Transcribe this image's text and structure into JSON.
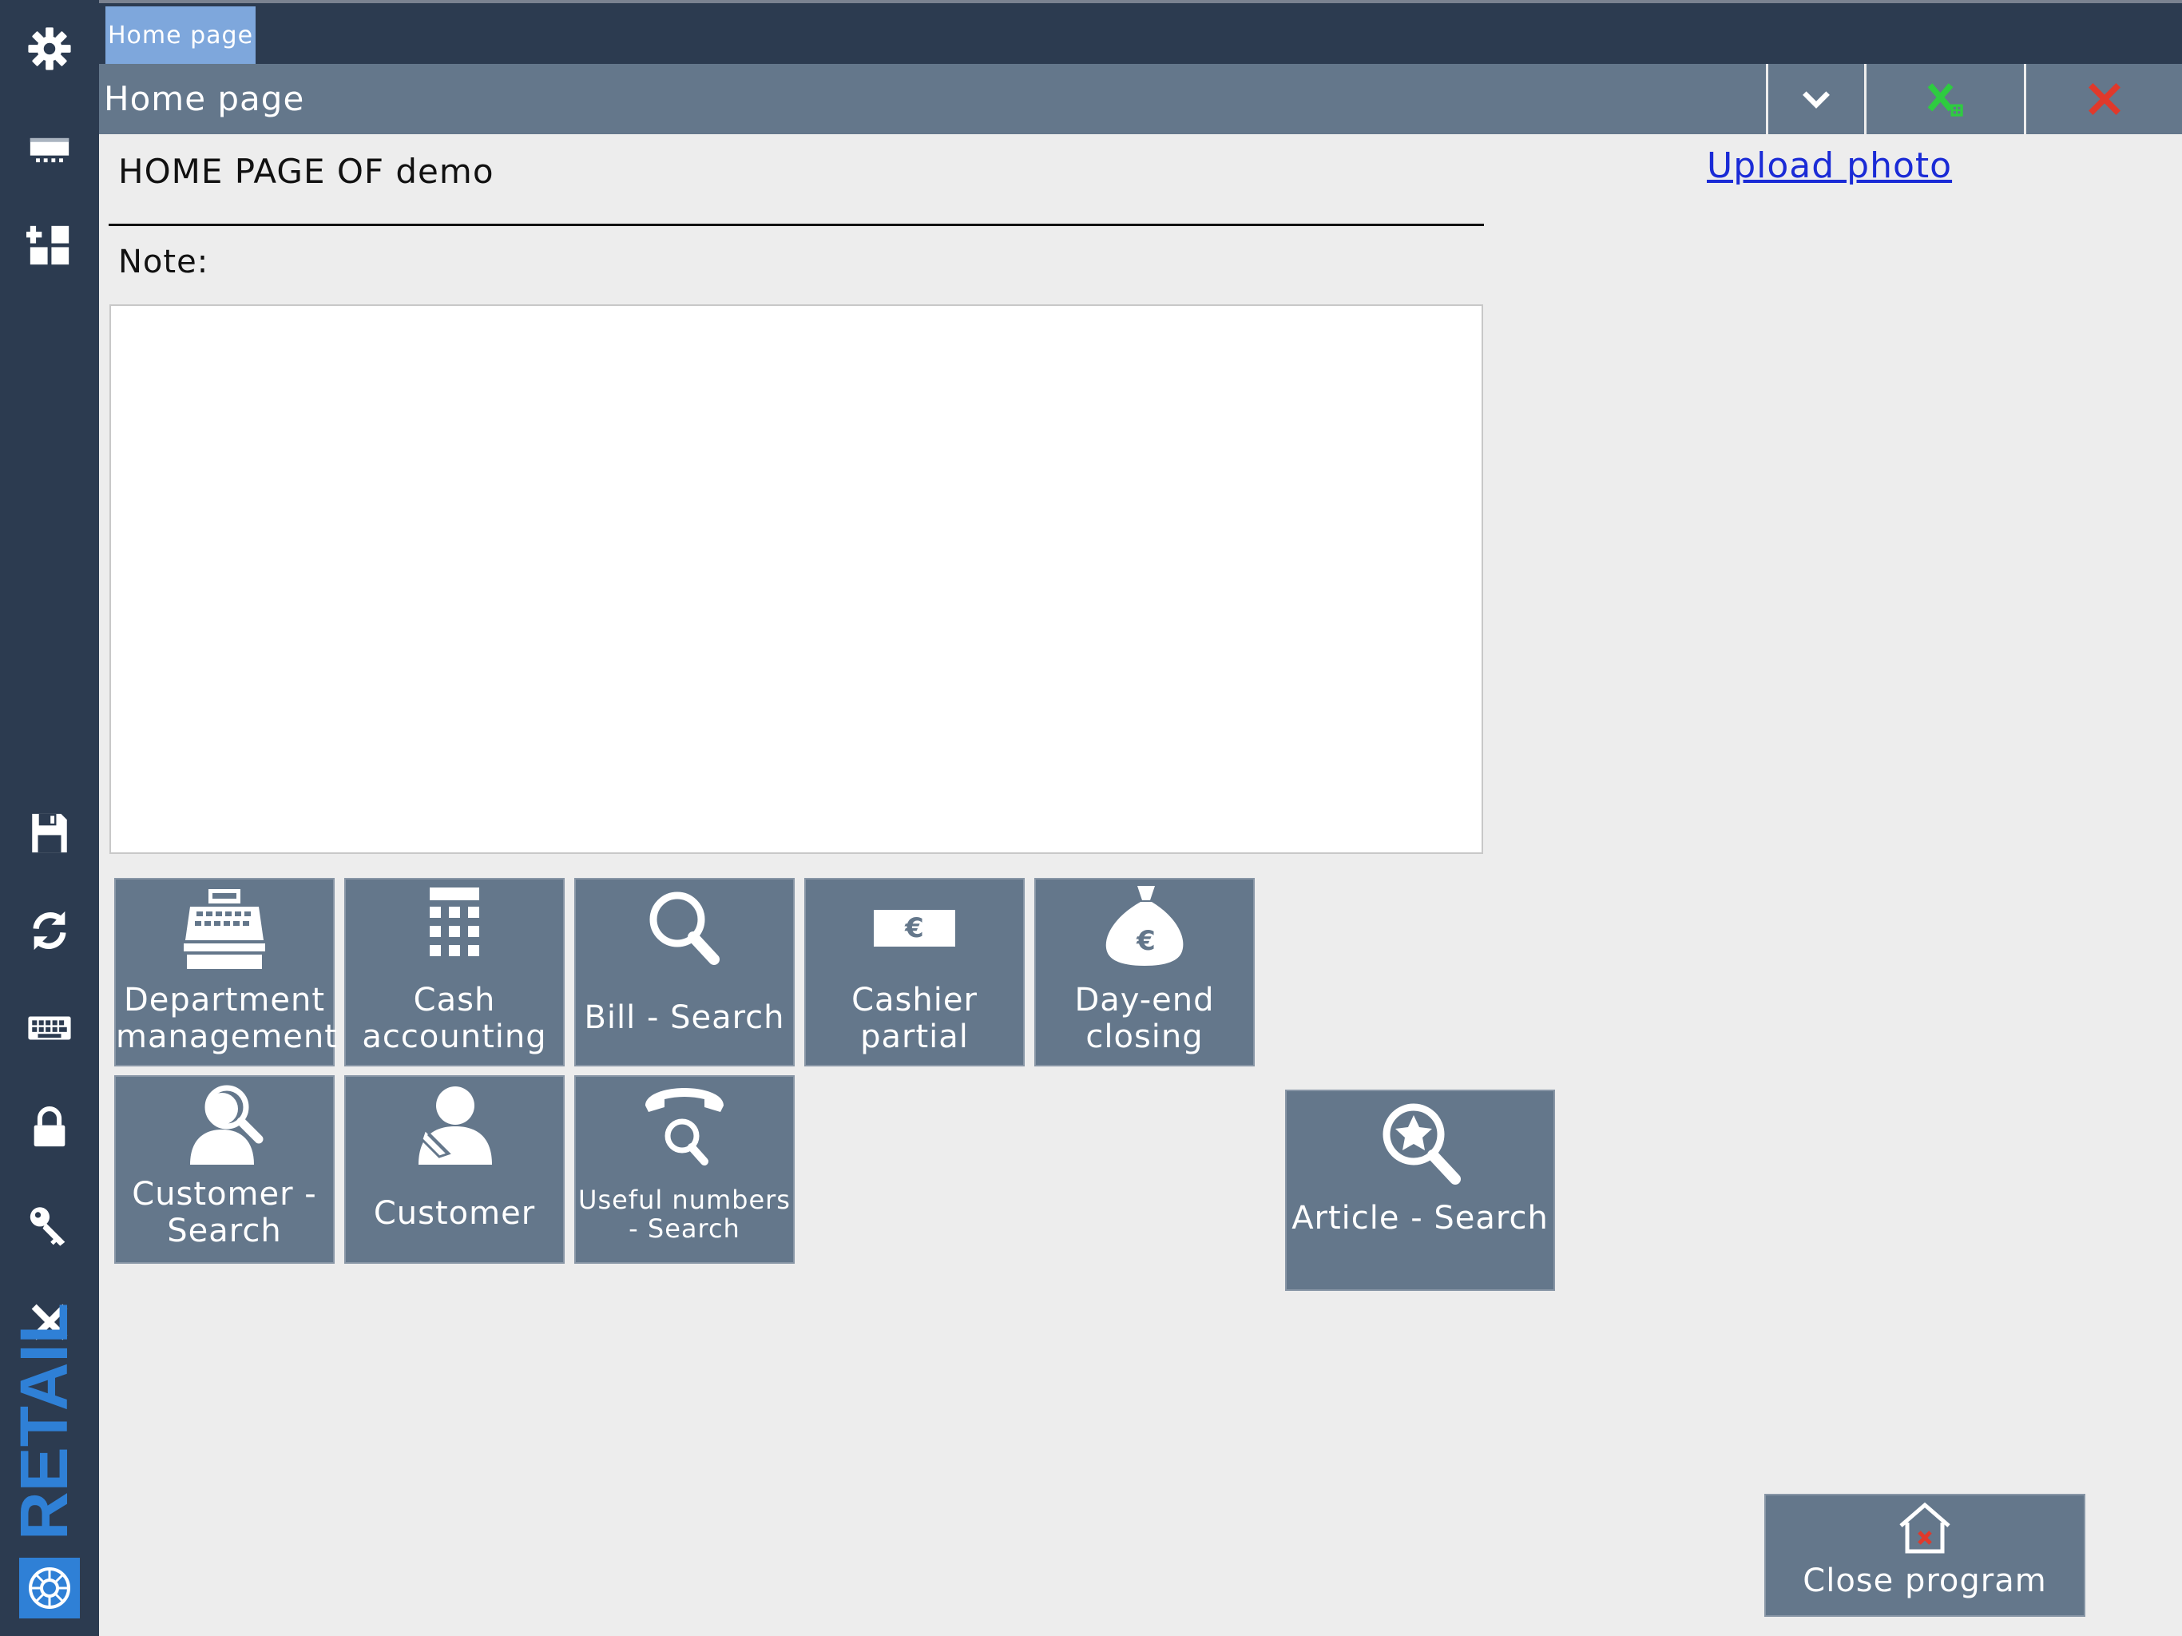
{
  "tabs": [
    {
      "label": "Home page"
    }
  ],
  "titlebar": {
    "title": "Home page"
  },
  "sidebar": {
    "top_icons": [
      "gear-icon",
      "monitor-icon",
      "dashboard-icon"
    ],
    "bottom_icons": [
      "save-icon",
      "refresh-icon",
      "keyboard-icon",
      "lock-icon",
      "key-icon",
      "close-icon"
    ],
    "brand": "RETAIL"
  },
  "main": {
    "heading": "HOME PAGE OF demo",
    "note_label": "Note:",
    "note_value": "",
    "upload_link": "Upload photo"
  },
  "tiles": [
    {
      "label": "Department management",
      "icon": "cash-register-icon"
    },
    {
      "label": "Cash accounting",
      "icon": "calculator-icon"
    },
    {
      "label": "Bill - Search",
      "icon": "magnifier-icon"
    },
    {
      "label": "Cashier partial",
      "icon": "euro-banknote-icon"
    },
    {
      "label": "Day-end closing",
      "icon": "money-bag-icon"
    },
    {
      "label": "Customer - Search",
      "icon": "person-search-icon"
    },
    {
      "label": "Customer",
      "icon": "person-edit-icon"
    },
    {
      "label": "Useful numbers - Search",
      "icon": "phone-search-icon"
    },
    {
      "label": "Article - Search",
      "icon": "star-search-icon"
    },
    {
      "label": "Close program",
      "icon": "house-close-icon"
    }
  ],
  "colors": {
    "sidebar": "#2c3b50",
    "tile": "#64778b",
    "active_tab": "#7ea7dc",
    "accent_green": "#2ecc40",
    "accent_red": "#e0392b",
    "link": "#1a2bd6"
  }
}
